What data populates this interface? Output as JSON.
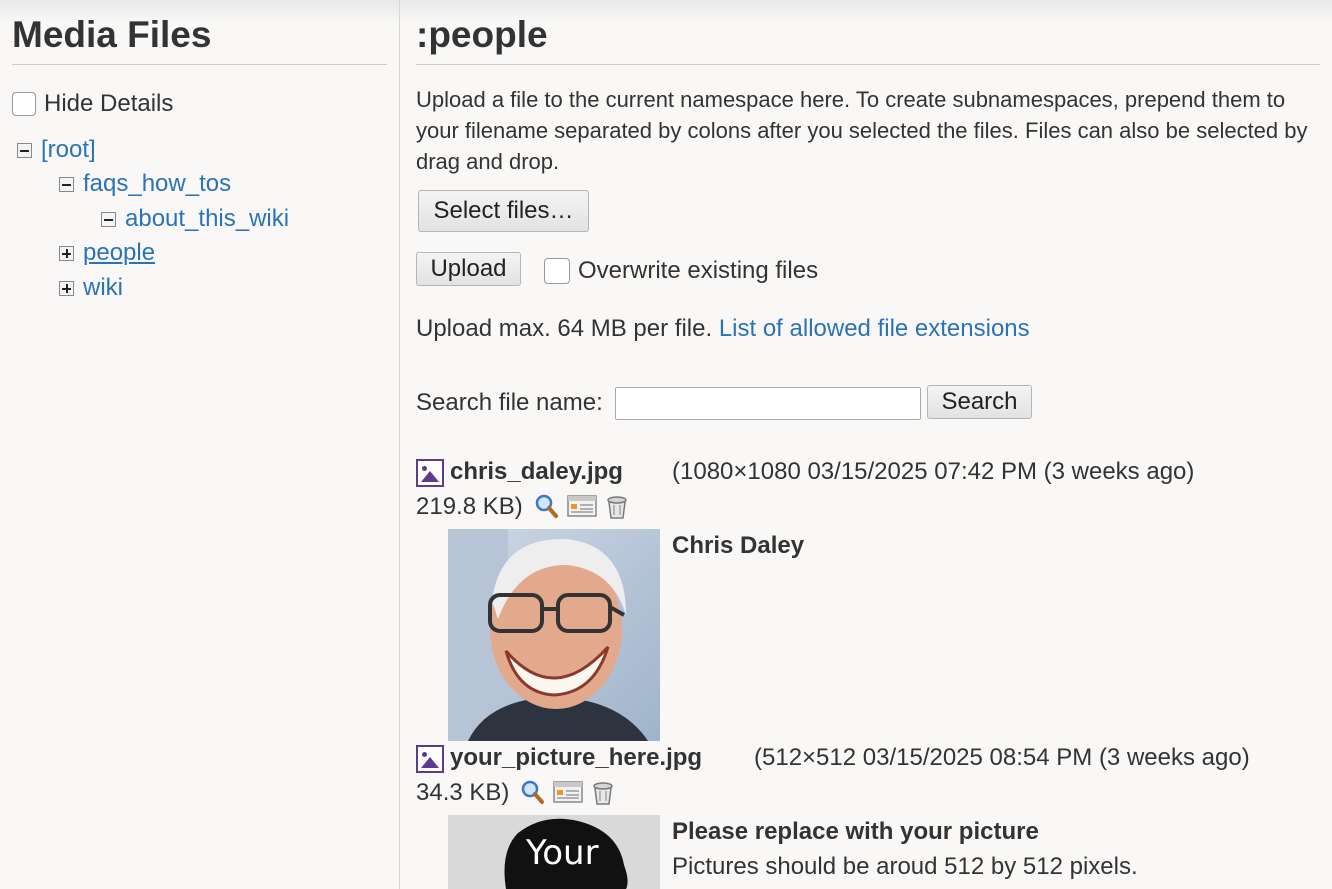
{
  "sidebar": {
    "title": "Media Files",
    "hide_details_label": "Hide Details",
    "tree": {
      "root": "[root]",
      "faqs_how_tos": "faqs_how_tos",
      "about_this_wiki": "about_this_wiki",
      "people": "people",
      "wiki": "wiki"
    }
  },
  "main": {
    "title": ":people",
    "description": "Upload a file to the current namespace here. To create subnamespaces, prepend them to your filename separated by colons after you selected the files. Files can also be selected by drag and drop.",
    "select_files_label": "Select files…",
    "upload_label": "Upload",
    "overwrite_label": "Overwrite existing files",
    "upload_max_text": "Upload max. 64 MB per file.",
    "allowed_ext_link": "List of allowed file extensions",
    "search_label": "Search file name:",
    "search_value": "",
    "search_button": "Search",
    "files": [
      {
        "name": "chris_daley.jpg",
        "meta_line1": "(1080×1080 03/15/2025 07:42 PM (3 weeks ago)",
        "meta_line2": "219.8 KB)",
        "title": "Chris Daley",
        "description": ""
      },
      {
        "name": "your_picture_here.jpg",
        "meta_line1": "(512×512 03/15/2025 08:54 PM (3 weeks ago)",
        "meta_line2": "34.3 KB)",
        "title": "Please replace with your picture",
        "description": "Pictures should be aroud 512 by 512 pixels.",
        "thumb_text": "Your"
      }
    ]
  },
  "icons": {
    "tree_collapse": "minus-box-icon",
    "tree_expand": "plus-box-icon",
    "file_type": "image-file-icon",
    "view": "magnifier-icon",
    "edit": "details-icon",
    "delete": "trash-icon"
  },
  "colors": {
    "link": "#2b73b7",
    "file_icon": "#5d3a8d",
    "background": "#f9f8f7"
  }
}
